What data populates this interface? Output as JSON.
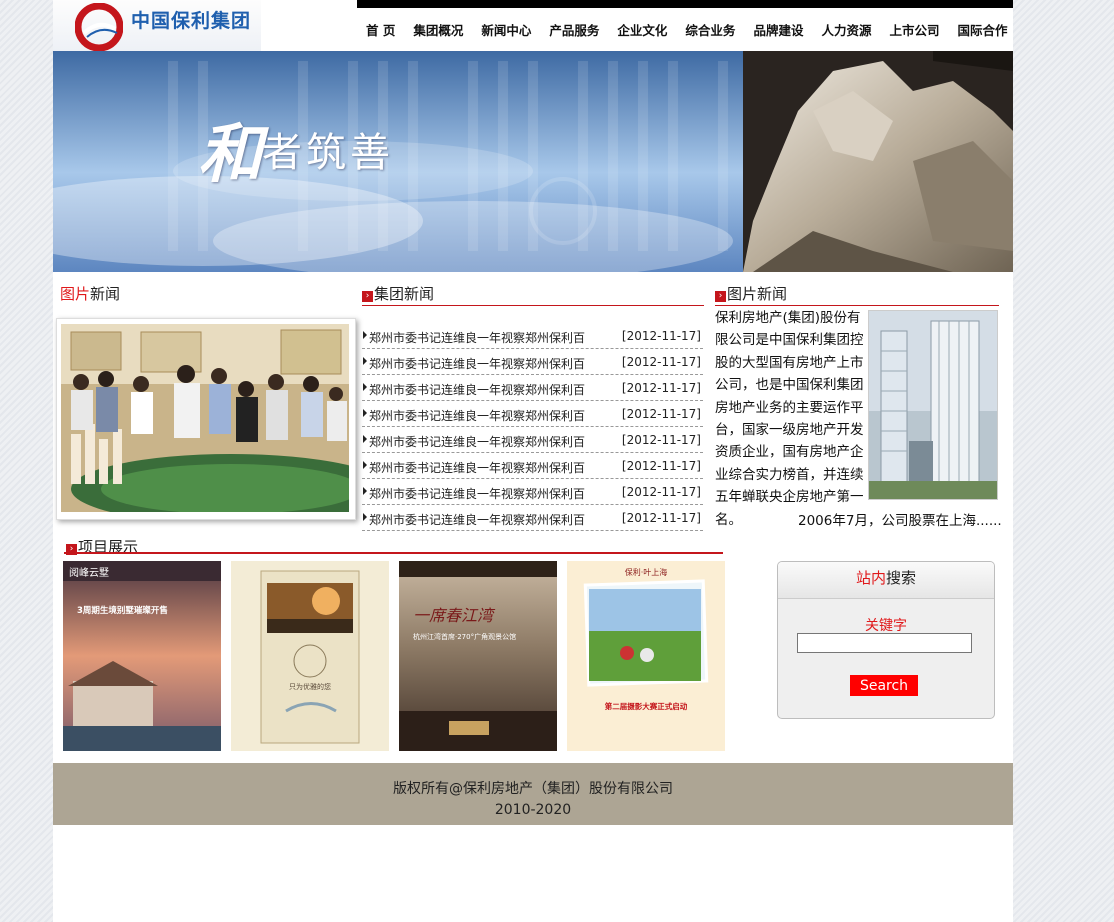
{
  "header": {
    "logo_text": "中国保利集团",
    "nav": [
      "首 页",
      "集团概况",
      "新闻中心",
      "产品服务",
      "企业文化",
      "综合业务",
      "品牌建设",
      "人力资源",
      "上市公司",
      "国际合作"
    ]
  },
  "banner": {
    "slogan_big": "和",
    "slogan_rest": "者筑善"
  },
  "photo_news": {
    "title_red": "图片",
    "title_rest": "新闻"
  },
  "group_news": {
    "title": "集团新闻",
    "items": [
      {
        "text": "郑州市委书记连维良一年视察郑州保利百",
        "date": "[2012-11-17]"
      },
      {
        "text": "郑州市委书记连维良一年视察郑州保利百",
        "date": "[2012-11-17]"
      },
      {
        "text": "郑州市委书记连维良一年视察郑州保利百",
        "date": "[2012-11-17]"
      },
      {
        "text": "郑州市委书记连维良一年视察郑州保利百",
        "date": "[2012-11-17]"
      },
      {
        "text": "郑州市委书记连维良一年视察郑州保利百",
        "date": "[2012-11-17]"
      },
      {
        "text": "郑州市委书记连维良一年视察郑州保利百",
        "date": "[2012-11-17]"
      },
      {
        "text": "郑州市委书记连维良一年视察郑州保利百",
        "date": "[2012-11-17]"
      },
      {
        "text": "郑州市委书记连维良一年视察郑州保利百",
        "date": "[2012-11-17]"
      }
    ]
  },
  "company": {
    "title": "图片新闻",
    "text": "保利房地产(集团)股份有限公司是中国保利集团控股的大型国有房地产上市公司，也是中国保利集团房地产业务的主要运作平台，国家一级房地产开发资质企业，国有房地产企业综合实力榜首，并连续五年蝉联央企房地产第一名。",
    "more": "2006年7月，公司股票在上海......"
  },
  "projects": {
    "title": "项目展示",
    "items": [
      {
        "name": "阅峰云墅",
        "caption": "3周期生境别墅璀璨开售"
      },
      {
        "name": "只为优雅的您",
        "caption": ""
      },
      {
        "name": "一席春江湾",
        "caption": "杭州江湾首席·270°广角观景公馆"
      },
      {
        "name": "保利·叶上海",
        "caption": "第二届摄影大赛正式启动"
      }
    ]
  },
  "search": {
    "title_red": "站内",
    "title_rest": "搜索",
    "keyword_label": "关键字",
    "input_value": "",
    "button_label": "Search"
  },
  "footer": {
    "line1": "版权所有@保利房地产（集团）股份有限公司",
    "line2": "2010-2020"
  },
  "colors": {
    "accent_red": "#c4161c",
    "footer_bg": "#ada594",
    "logo_blue": "#1f5fae"
  }
}
